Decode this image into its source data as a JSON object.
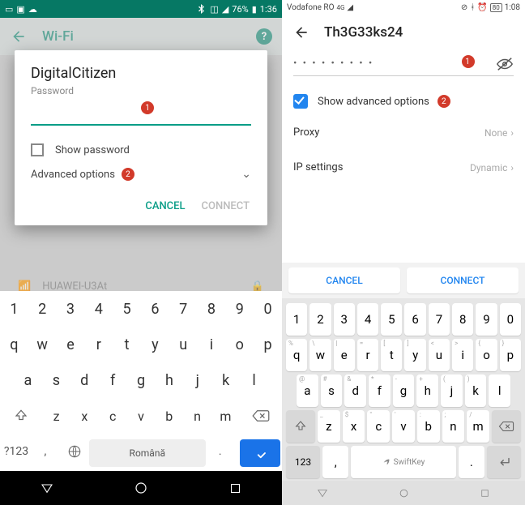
{
  "left": {
    "status": {
      "battery": "76%",
      "time": "1:36"
    },
    "appbar": {
      "title": "Wi-Fi"
    },
    "dialog": {
      "title": "DigitalCitizen",
      "subtitle": "Password",
      "show_password": "Show password",
      "advanced": "Advanced options",
      "cancel": "CANCEL",
      "connect": "CONNECT"
    },
    "badge1": "1",
    "badge2": "2",
    "bg_network": "HUAWEI-U3At",
    "keyboard": {
      "row1": [
        "1",
        "2",
        "3",
        "4",
        "5",
        "6",
        "7",
        "8",
        "9",
        "0"
      ],
      "row2": [
        "q",
        "w",
        "e",
        "r",
        "t",
        "y",
        "u",
        "i",
        "o",
        "p"
      ],
      "row3": [
        "a",
        "s",
        "d",
        "f",
        "g",
        "h",
        "j",
        "k",
        "l"
      ],
      "row4": [
        "z",
        "x",
        "c",
        "v",
        "b",
        "n",
        "m"
      ],
      "sym": "?123",
      "comma": ",",
      "dot": ".",
      "space": "Română"
    }
  },
  "right": {
    "status": {
      "carrier": "Vodafone RO",
      "battery": "80",
      "time": "1:08"
    },
    "header": {
      "title": "Th3G33ks24"
    },
    "password_mask": "• • • • • • • • •",
    "show_advanced": "Show advanced options",
    "badge1": "1",
    "badge2": "2",
    "settings": {
      "proxy_label": "Proxy",
      "proxy_value": "None",
      "ip_label": "IP settings",
      "ip_value": "Dynamic"
    },
    "buttons": {
      "cancel": "CANCEL",
      "connect": "CONNECT"
    },
    "keyboard": {
      "row1": [
        "1",
        "2",
        "3",
        "4",
        "5",
        "6",
        "7",
        "8",
        "9",
        "0"
      ],
      "row2": [
        {
          "k": "q",
          "h": "%"
        },
        {
          "k": "w",
          "h": "\\"
        },
        {
          "k": "e",
          "h": "|"
        },
        {
          "k": "r",
          "h": "="
        },
        {
          "k": "t",
          "h": "["
        },
        {
          "k": "y",
          "h": "]"
        },
        {
          "k": "u",
          "h": "<"
        },
        {
          "k": "i",
          "h": ">"
        },
        {
          "k": "o",
          "h": "{"
        },
        {
          "k": "p",
          "h": "}"
        }
      ],
      "row3": [
        {
          "k": "a",
          "h": "@"
        },
        {
          "k": "s",
          "h": "#"
        },
        {
          "k": "d",
          "h": "&"
        },
        {
          "k": "f",
          "h": "*"
        },
        {
          "k": "g",
          "h": "-"
        },
        {
          "k": "h",
          "h": "+"
        },
        {
          "k": "j",
          "h": "("
        },
        {
          "k": "k",
          "h": ")"
        },
        {
          "k": "l"
        }
      ],
      "row4": [
        {
          "k": "z",
          "h": "_"
        },
        {
          "k": "x",
          "h": "$"
        },
        {
          "k": "c",
          "h": "\""
        },
        {
          "k": "v",
          "h": "'"
        },
        {
          "k": "b",
          "h": ":"
        },
        {
          "k": "n",
          "h": ";"
        },
        {
          "k": "m",
          "h": "/"
        }
      ],
      "sym": "123",
      "comma": ",",
      "dot": ".",
      "space": "SwiftKey"
    }
  }
}
